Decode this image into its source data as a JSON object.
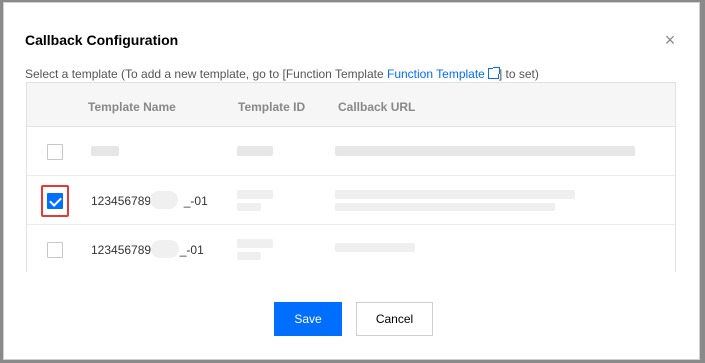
{
  "dialog": {
    "title": "Callback Configuration",
    "close_glyph": "×",
    "hint_prefix": "Select a template (To add a new template, go to [Function Template ",
    "hint_link": "Function Template",
    "hint_suffix": "] to set)"
  },
  "table": {
    "headers": [
      "Template Name",
      "Template ID",
      "Callback URL"
    ],
    "rows": [
      {
        "name": "",
        "checked": false
      },
      {
        "name_prefix": "1234567890",
        "name_suffix": "_-01",
        "checked": true
      },
      {
        "name_prefix": "1234567890",
        "name_suffix": "_-01",
        "checked": false
      }
    ]
  },
  "buttons": {
    "save": "Save",
    "cancel": "Cancel"
  },
  "colors": {
    "primary": "#006eff",
    "highlight": "#e53935"
  },
  "icons": [
    "close-icon",
    "external-link-icon",
    "checkbox-icon"
  ]
}
